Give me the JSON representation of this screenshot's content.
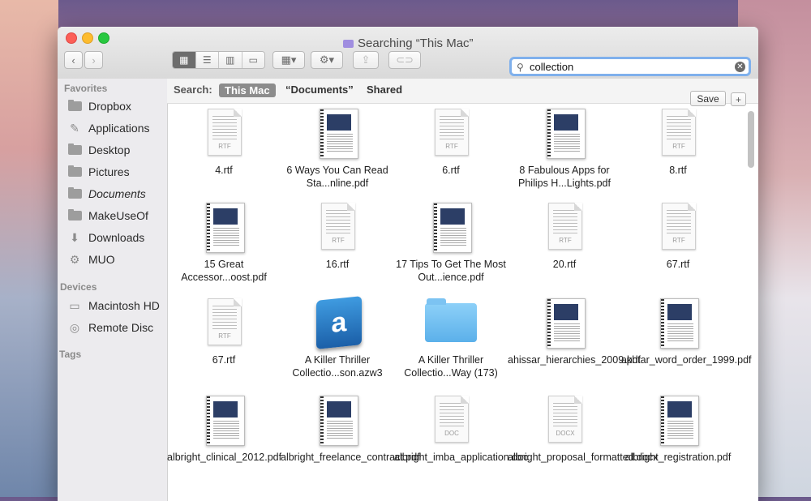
{
  "window": {
    "title": "Searching “This Mac”"
  },
  "toolbar": {
    "back": "‹",
    "forward": "›",
    "views": [
      "▦",
      "☰",
      "▥",
      "▭"
    ],
    "arrange": "▦▾",
    "action": "⚙▾",
    "share": "⇪",
    "tag": "⊂⊃"
  },
  "search": {
    "value": "collection",
    "placeholder": "Search",
    "clear": "✕"
  },
  "sidebar": {
    "favorites_heading": "Favorites",
    "favorites": [
      {
        "label": "Dropbox",
        "icon": "folder-icon"
      },
      {
        "label": "Applications",
        "icon": "applications-icon"
      },
      {
        "label": "Desktop",
        "icon": "folder-icon"
      },
      {
        "label": "Pictures",
        "icon": "folder-icon"
      },
      {
        "label": "Documents",
        "icon": "folder-icon"
      },
      {
        "label": "MakeUseOf",
        "icon": "folder-icon"
      },
      {
        "label": "Downloads",
        "icon": "downloads-icon"
      },
      {
        "label": "MUO",
        "icon": "gear-icon"
      }
    ],
    "devices_heading": "Devices",
    "devices": [
      {
        "label": "Macintosh HD",
        "icon": "harddisk-icon"
      },
      {
        "label": "Remote Disc",
        "icon": "disc-icon"
      }
    ],
    "tags_heading": "Tags"
  },
  "scopebar": {
    "label": "Search:",
    "scopes": [
      "This Mac",
      "“Documents”",
      "Shared"
    ],
    "save": "Save",
    "add": "+"
  },
  "files": [
    {
      "name": "4.rtf",
      "kind": "rtf"
    },
    {
      "name": "6 Ways You Can Read Sta...nline.pdf",
      "kind": "pdf"
    },
    {
      "name": "6.rtf",
      "kind": "rtf"
    },
    {
      "name": "8 Fabulous Apps for Philips H...Lights.pdf",
      "kind": "pdf"
    },
    {
      "name": "8.rtf",
      "kind": "rtf"
    },
    {
      "name": "15 Great Accessor...oost.pdf",
      "kind": "pdf"
    },
    {
      "name": "16.rtf",
      "kind": "rtf"
    },
    {
      "name": "17 Tips To Get The Most Out...ience.pdf",
      "kind": "pdf"
    },
    {
      "name": "20.rtf",
      "kind": "rtf"
    },
    {
      "name": "67.rtf",
      "kind": "rtf"
    },
    {
      "name": "67.rtf",
      "kind": "rtf"
    },
    {
      "name": "A Killer Thriller Collectio...son.azw3",
      "kind": "azw"
    },
    {
      "name": "A Killer Thriller Collectio...Way (173)",
      "kind": "folder"
    },
    {
      "name": "ahissar_hierarchies_2009.pdf",
      "kind": "pdf"
    },
    {
      "name": "akhtar_word_order_1999.pdf",
      "kind": "pdf"
    },
    {
      "name": "albright_clinical_2012.pdf",
      "kind": "pdf"
    },
    {
      "name": "albright_freelance_contract.pdf",
      "kind": "pdf"
    },
    {
      "name": "albright_imba_application.doc",
      "kind": "doc"
    },
    {
      "name": "albright_proposal_formatted.docx",
      "kind": "docx"
    },
    {
      "name": "albright_registration.pdf",
      "kind": "pdf"
    }
  ],
  "file_tags": {
    "rtf": "RTF",
    "doc": "DOC",
    "docx": "DOCX"
  }
}
